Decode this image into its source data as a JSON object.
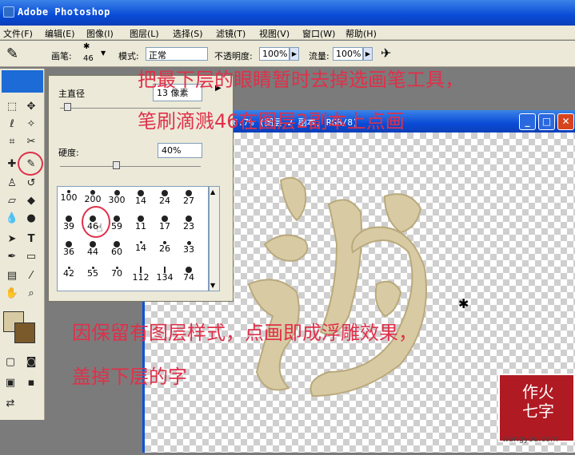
{
  "app": {
    "title": "Adobe Photoshop"
  },
  "menu": [
    "文件(F)",
    "编辑(E)",
    "图像(I)",
    "图层(L)",
    "选择(S)",
    "滤镜(T)",
    "视图(V)",
    "窗口(W)",
    "帮助(H)"
  ],
  "options": {
    "brush_label": "画笔:",
    "brush_size": "46",
    "mode_label": "模式:",
    "mode_value": "正常",
    "opacity_label": "不透明度:",
    "opacity_value": "100%",
    "flow_label": "流量:",
    "flow_value": "100%"
  },
  "brush_panel": {
    "diameter_label": "主直径",
    "diameter_value": "13 像素",
    "hardness_label": "硬度:",
    "hardness_value": "40%",
    "diameter_level": 0.05,
    "hardness_level": 0.4,
    "presets_row1": [
      "100",
      "200",
      "300",
      "14",
      "24",
      "27"
    ],
    "presets_row2": [
      "39",
      "46",
      "59",
      "11",
      "17",
      "23"
    ],
    "presets_row3": [
      "36",
      "44",
      "60",
      "14",
      "26",
      "33"
    ],
    "presets_row4": [
      "42",
      "55",
      "70",
      "112",
      "134",
      "74"
    ]
  },
  "document": {
    "title": "6.7% (图层 2 副本, RGB/8)"
  },
  "annotations": {
    "line1": "把最下层的眼睛暂时去掉选画笔工具，",
    "line2": "笔刷滴溅46在图层2副本上点画",
    "line3": "因保留有图层样式，点画即成浮雕效果，",
    "line4": "盖掉下层的字"
  },
  "stamp": {
    "text": "作七火字",
    "site": "wangyou.com"
  },
  "colors": {
    "accent": "#e0304a",
    "titlebar": "#0a4bd6",
    "sand": "#d8cba4"
  }
}
